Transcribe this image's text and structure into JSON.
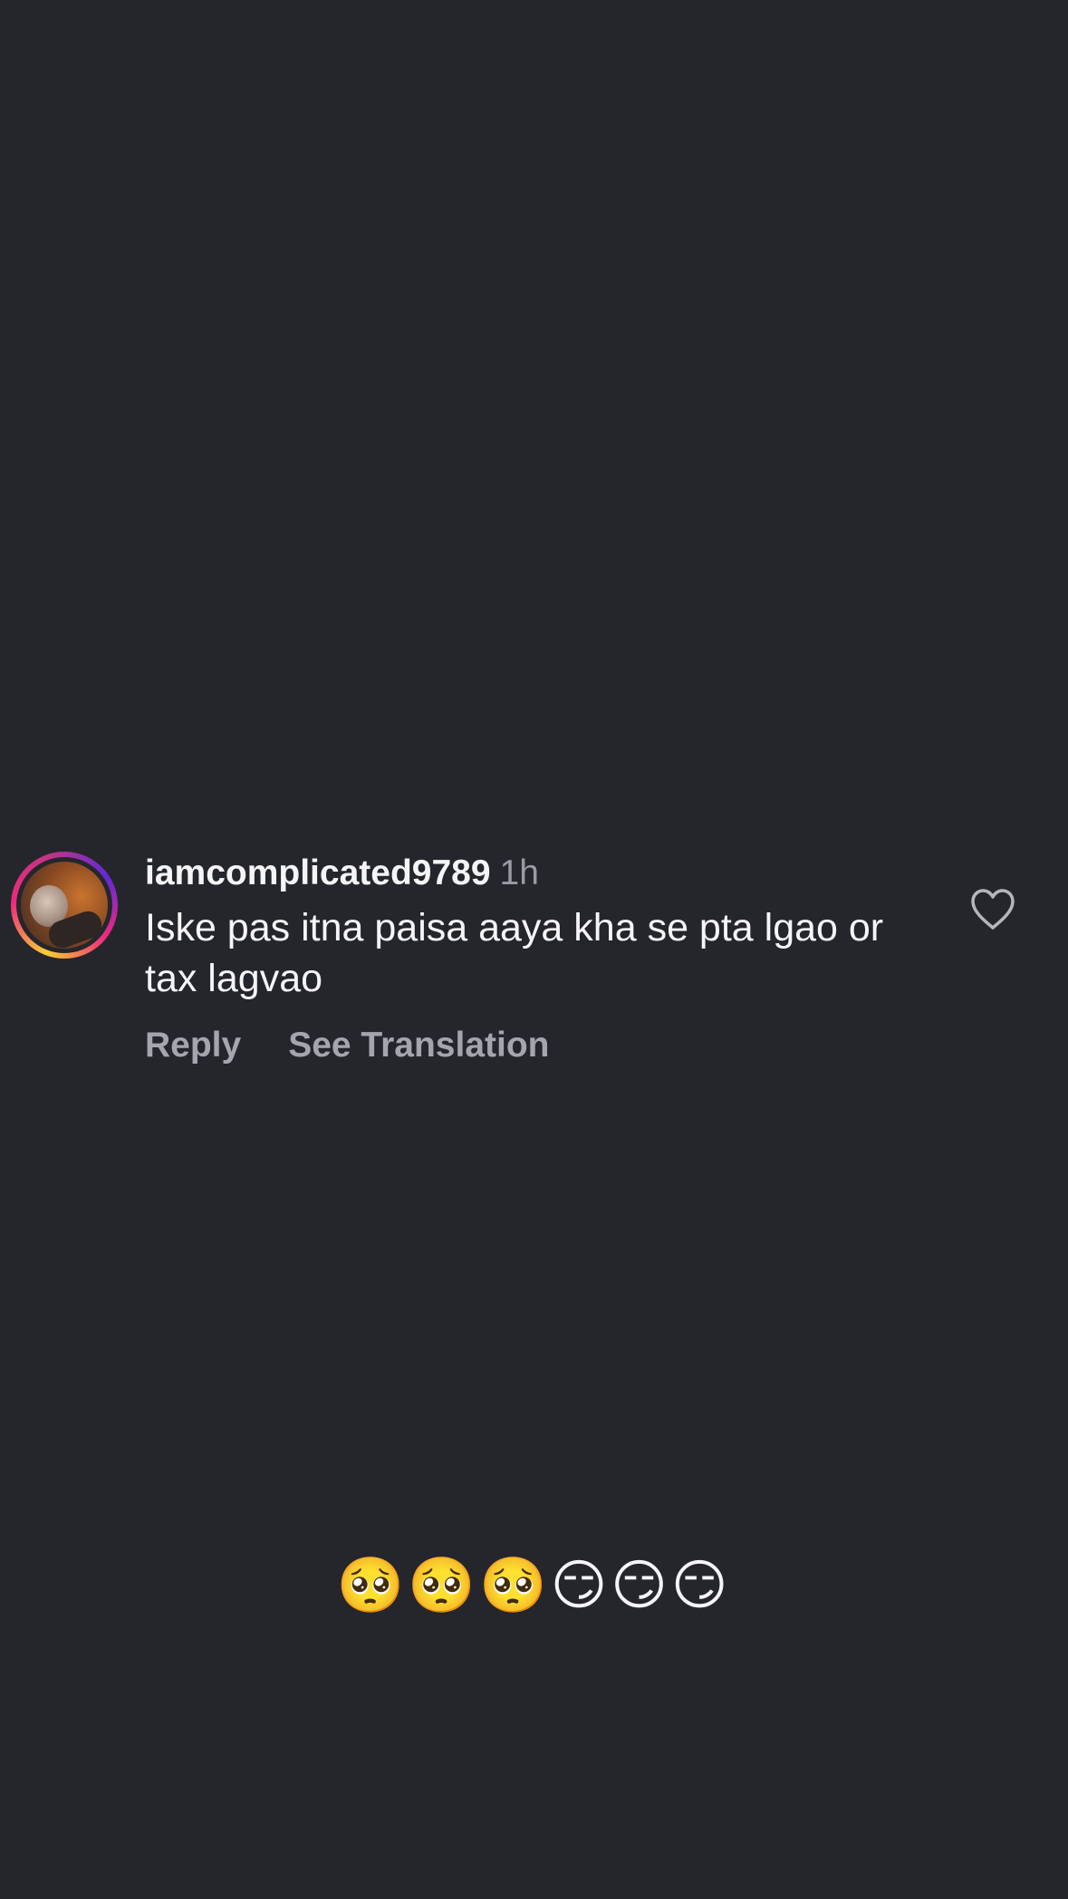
{
  "comment": {
    "username": "iamcomplicated9789",
    "time": "1h",
    "text": "Iske pas itna paisa aaya kha se pta lgao or tax lagvao",
    "reply_label": "Reply",
    "translate_label": "See Translation",
    "like_icon": "heart-outline-icon",
    "avatar_ring_colors": [
      "#f9ce34",
      "#ee2a7b",
      "#6228d7"
    ]
  },
  "caption": {
    "emojis": "🥺🥺🥺😏😏😏"
  },
  "colors": {
    "background": "#24262b",
    "primary_text": "#f5f5f7",
    "secondary_text": "#9a9ca3"
  }
}
